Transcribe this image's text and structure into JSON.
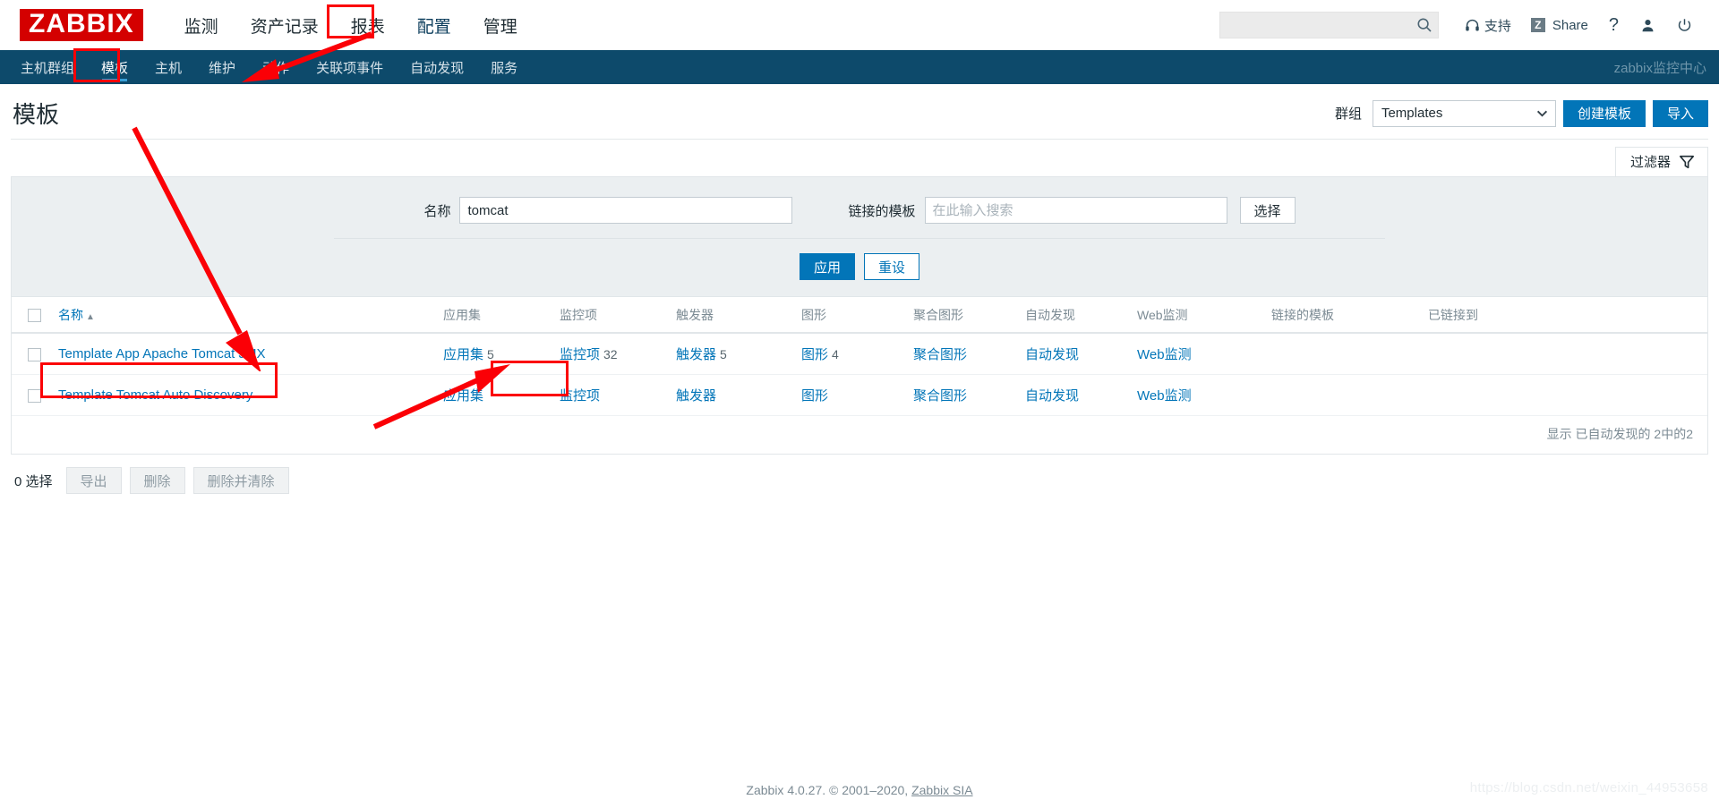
{
  "header": {
    "logo": "ZABBIX",
    "menu": [
      {
        "label": "监测"
      },
      {
        "label": "资产记录"
      },
      {
        "label": "报表"
      },
      {
        "label": "配置"
      },
      {
        "label": "管理"
      }
    ],
    "selected_menu": "配置",
    "search": {
      "value": "",
      "placeholder": ""
    },
    "support_label": "支持",
    "share_label": "Share",
    "share_badge": "Z",
    "help_icon": "?",
    "user_icon": "user-icon",
    "power_icon": "power-icon"
  },
  "subnav": {
    "items": [
      {
        "label": "主机群组"
      },
      {
        "label": "模板"
      },
      {
        "label": "主机"
      },
      {
        "label": "维护"
      },
      {
        "label": "动作"
      },
      {
        "label": "关联项事件"
      },
      {
        "label": "自动发现"
      },
      {
        "label": "服务"
      }
    ],
    "selected": "模板",
    "user_label": "zabbix监控中心"
  },
  "page": {
    "title": "模板",
    "group_label": "群组",
    "group_value": "Templates",
    "create_button": "创建模板",
    "import_button": "导入"
  },
  "filter": {
    "tab_label": "过滤器",
    "tab_icon": "funnel-icon",
    "name_label": "名称",
    "name_value": "tomcat",
    "linked_label": "链接的模板",
    "linked_value": "",
    "linked_placeholder": "在此输入搜索",
    "select_button": "选择",
    "apply_button": "应用",
    "reset_button": "重设"
  },
  "table": {
    "columns": [
      "名称",
      "应用集",
      "监控项",
      "触发器",
      "图形",
      "聚合图形",
      "自动发现",
      "Web监测",
      "链接的模板",
      "已链接到"
    ],
    "sort_column": "名称",
    "sort_dir": "▲",
    "rows": [
      {
        "name": "Template App Apache Tomcat JMX",
        "applications": {
          "label": "应用集",
          "count": "5"
        },
        "items": {
          "label": "监控项",
          "count": "32"
        },
        "triggers": {
          "label": "触发器",
          "count": "5"
        },
        "graphs": {
          "label": "图形",
          "count": "4"
        },
        "screens": {
          "label": "聚合图形",
          "count": ""
        },
        "discovery": {
          "label": "自动发现",
          "count": ""
        },
        "web": {
          "label": "Web监测",
          "count": ""
        },
        "linked_templates": "",
        "linked_to": ""
      },
      {
        "name": "Template Tomcat Auto Discovery",
        "applications": {
          "label": "应用集",
          "count": ""
        },
        "items": {
          "label": "监控项",
          "count": ""
        },
        "triggers": {
          "label": "触发器",
          "count": ""
        },
        "graphs": {
          "label": "图形",
          "count": ""
        },
        "screens": {
          "label": "聚合图形",
          "count": ""
        },
        "discovery": {
          "label": "自动发现",
          "count": ""
        },
        "web": {
          "label": "Web监测",
          "count": ""
        },
        "linked_templates": "",
        "linked_to": ""
      }
    ],
    "paging_text": "显示 已自动发现的 2中的2"
  },
  "footer_actions": {
    "selected_text": "0 选择",
    "export_button": "导出",
    "delete_button": "删除",
    "delete_clear_button": "删除并清除"
  },
  "footer": {
    "text": "Zabbix 4.0.27. © 2001–2020,",
    "link": "Zabbix SIA",
    "watermark": "https://blog.csdn.net/weixin_44953658"
  }
}
